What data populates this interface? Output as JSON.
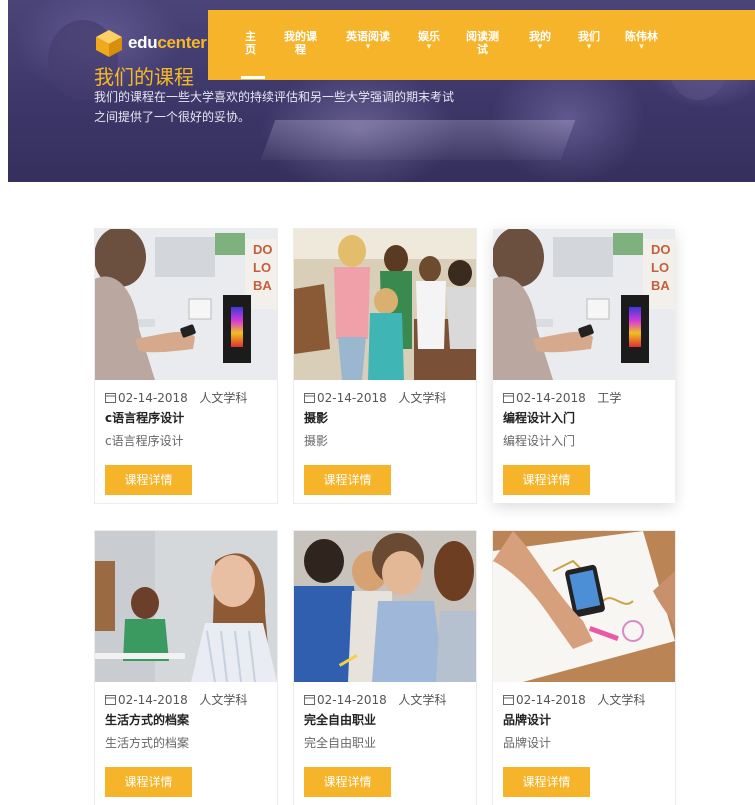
{
  "brand": {
    "name_part1": "edu",
    "name_part2": "center"
  },
  "hero": {
    "title": "我们的课程",
    "description_line1": "我们的课程在一些大学喜欢的持续评估和另一些大学强调的期末考试",
    "description_line2": "之间提供了一个很好的妥协。"
  },
  "nav": {
    "items": [
      {
        "line1": "主",
        "line2": "页",
        "caret": ""
      },
      {
        "line1": "我的课",
        "line2": "程",
        "caret": ""
      },
      {
        "line1": "英语阅读",
        "line2": "",
        "caret": "▾"
      },
      {
        "line1": "娱乐",
        "line2": "",
        "caret": "▾"
      },
      {
        "line1": "阅读测",
        "line2": "试",
        "caret": ""
      },
      {
        "line1": "我的",
        "line2": "",
        "caret": "▾"
      },
      {
        "line1": "我们",
        "line2": "",
        "caret": "▾"
      },
      {
        "line1": "陈伟林",
        "line2": "",
        "caret": "▾"
      }
    ]
  },
  "courses": [
    {
      "date": "02-14-2018",
      "category": "人文学科",
      "title": "c语言程序设计",
      "subtitle": "c语言程序设计",
      "button": "课程详情",
      "image": "phone-at-wall"
    },
    {
      "date": "02-14-2018",
      "category": "人文学科",
      "title": "摄影",
      "subtitle": "摄影",
      "button": "课程详情",
      "image": "students-group"
    },
    {
      "date": "02-14-2018",
      "category": "工学",
      "title": "编程设计入门",
      "subtitle": "编程设计入门",
      "button": "课程详情",
      "image": "phone-at-wall"
    },
    {
      "date": "02-14-2018",
      "category": "人文学科",
      "title": "生活方式的档案",
      "subtitle": "生活方式的档案",
      "button": "课程详情",
      "image": "woman-classroom"
    },
    {
      "date": "02-14-2018",
      "category": "人文学科",
      "title": "完全自由职业",
      "subtitle": "完全自由职业",
      "button": "课程详情",
      "image": "students-writing"
    },
    {
      "date": "02-14-2018",
      "category": "人文学科",
      "title": "品牌设计",
      "subtitle": "品牌设计",
      "button": "课程详情",
      "image": "hands-sketching"
    }
  ],
  "colors": {
    "accent": "#f6b42a",
    "hero_bg": "#3c3668",
    "title_text": "#222222"
  },
  "icons": {
    "calendar": "calendar-icon",
    "logo": "logo-cube-icon"
  }
}
